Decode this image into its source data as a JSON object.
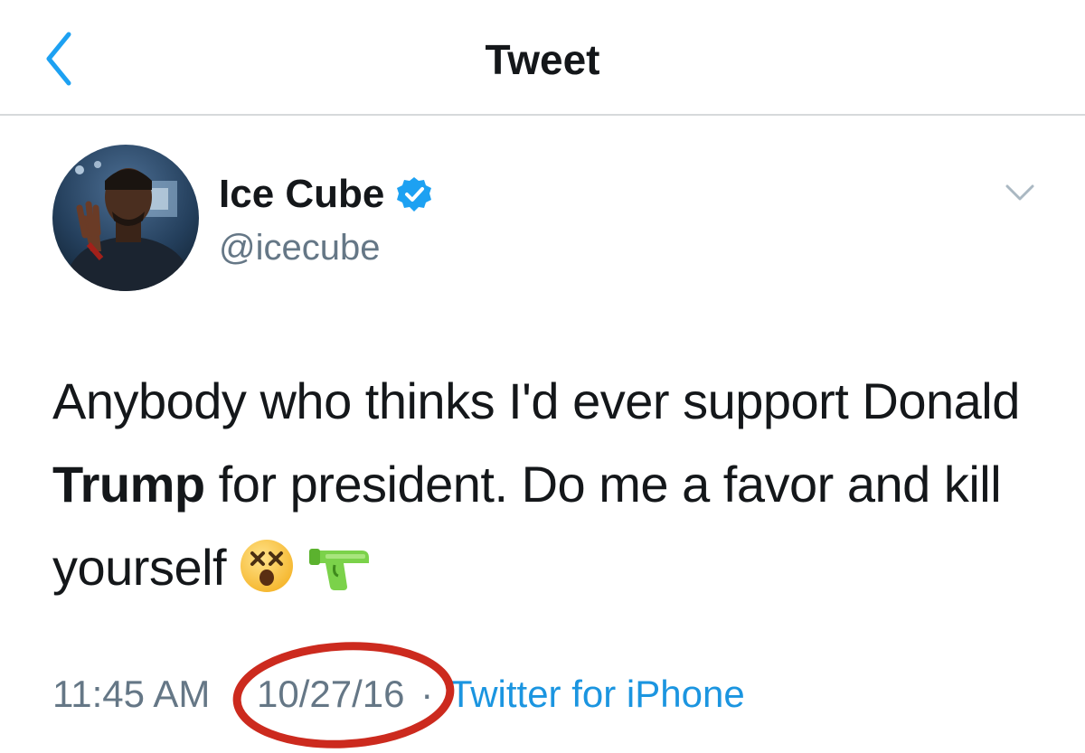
{
  "header": {
    "title": "Tweet",
    "back_icon": "chevron-left-icon"
  },
  "author": {
    "display_name": "Ice Cube",
    "handle": "@icecube",
    "verified": true
  },
  "tweet": {
    "text_before": "Anybody who thinks I'd ever support Donald ",
    "text_bold": "Trump",
    "text_after": " for president. Do me a favor and kill yourself",
    "emojis": [
      "dizzy-face-emoji",
      "pistol-emoji"
    ]
  },
  "meta": {
    "time": "11:45 AM",
    "date": "10/27/16",
    "separator": "·",
    "source": "Twitter for iPhone"
  },
  "colors": {
    "accent": "#1da1f2",
    "link": "#1b95e0",
    "secondary_text": "#657786",
    "annotation": "#cc2a1e"
  }
}
